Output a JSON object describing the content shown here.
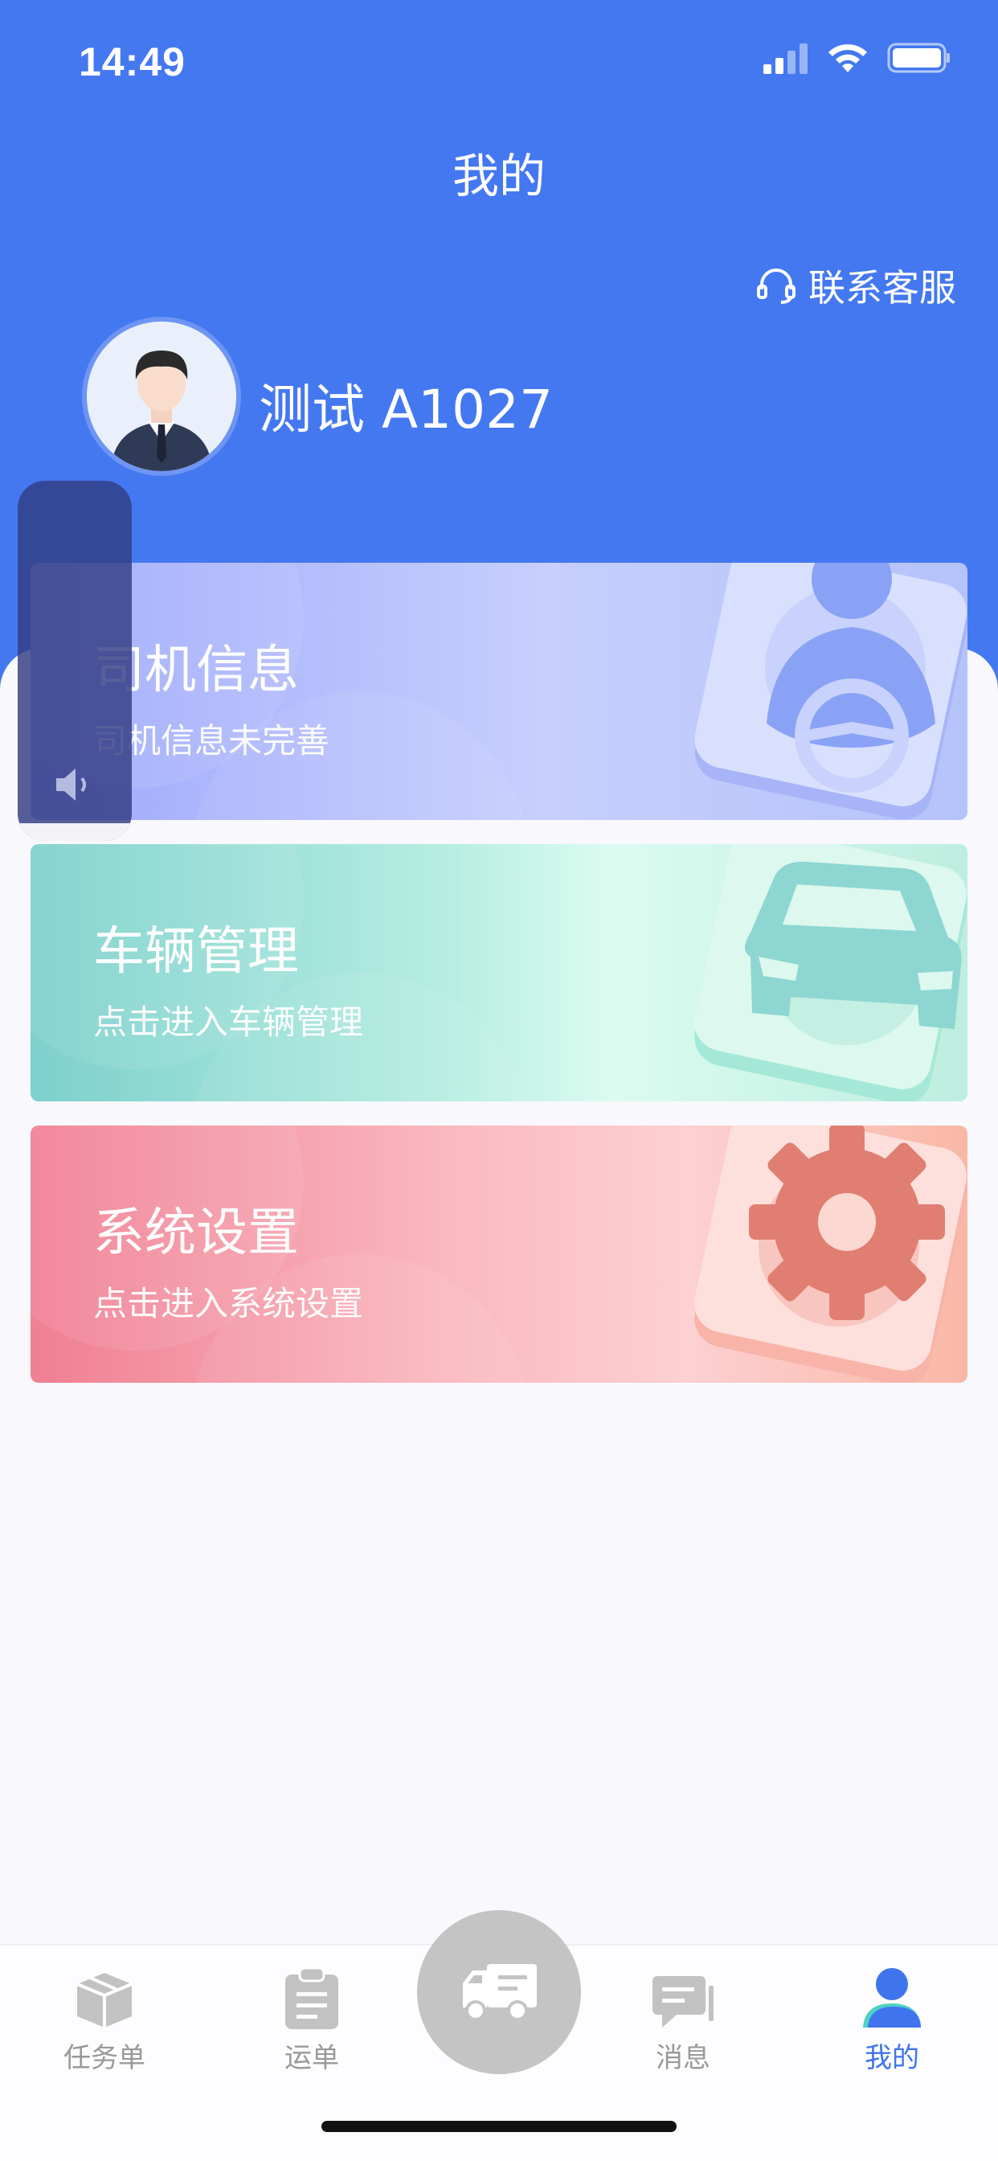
{
  "status_bar": {
    "time": "14:49"
  },
  "header": {
    "title": "我的",
    "contact_label": "联系客服",
    "username": "测试 A1027"
  },
  "cards": [
    {
      "title": "司机信息",
      "subtitle": "司机信息未完善"
    },
    {
      "title": "车辆管理",
      "subtitle": "点击进入车辆管理"
    },
    {
      "title": "系统设置",
      "subtitle": "点击进入系统设置"
    }
  ],
  "volume": {
    "level": 0.05
  },
  "tabbar": {
    "items": [
      {
        "label": "任务单",
        "icon": "box-icon"
      },
      {
        "label": "运单",
        "icon": "clipboard-icon"
      },
      {
        "label": "",
        "icon": "truck-icon"
      },
      {
        "label": "消息",
        "icon": "chat-icon"
      },
      {
        "label": "我的",
        "icon": "person-icon",
        "active": true
      }
    ]
  },
  "colors": {
    "primary": "#4478f1",
    "tab_active": "#3f74ee",
    "tab_inactive": "#999999"
  }
}
